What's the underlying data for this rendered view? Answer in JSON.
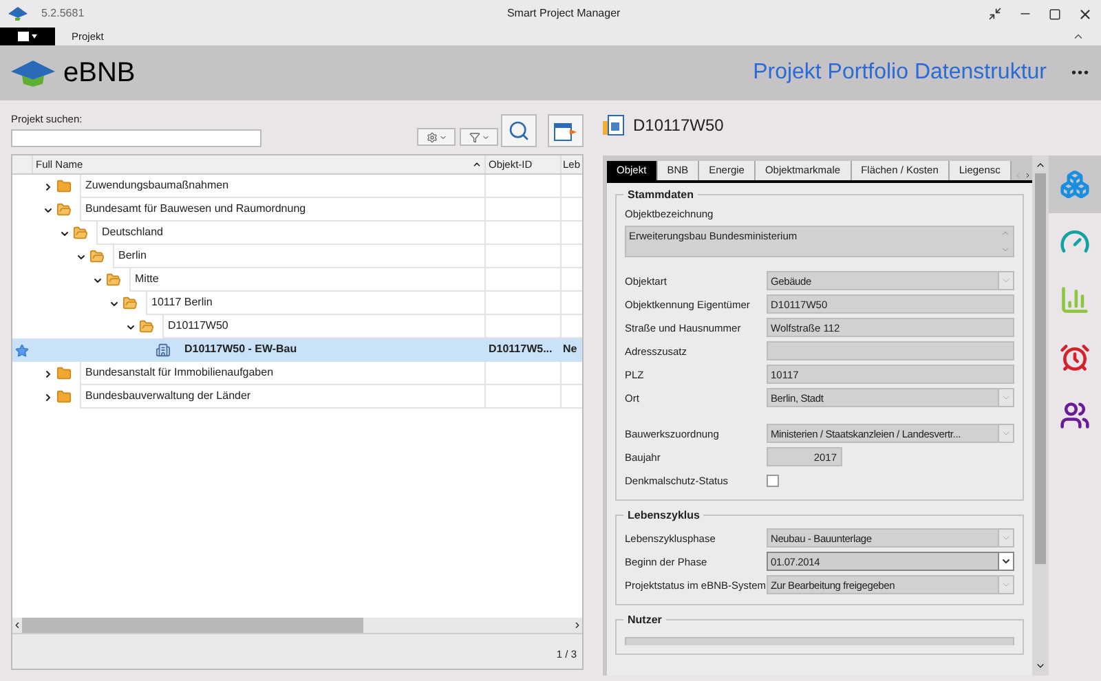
{
  "titlebar": {
    "version": "5.2.5681",
    "title": "Smart Project Manager"
  },
  "ribbon": {
    "tabs": [
      {
        "label": "Projekt",
        "selected": false
      }
    ]
  },
  "header": {
    "logo_text": "eBNB",
    "title": "Projekt Portfolio Datenstruktur",
    "more": "•••"
  },
  "search": {
    "label": "Projekt suchen:"
  },
  "tree": {
    "columns": [
      "Full Name",
      "Objekt-ID",
      "Leb"
    ],
    "rows": [
      {
        "name": "Zuwendungsbaumaßnahmen",
        "kind": "folder",
        "expanded": false,
        "selected": false,
        "favorite": false
      },
      {
        "name": "Bundesamt für Bauwesen und Raumordnung",
        "kind": "folder",
        "expanded": true,
        "selected": false,
        "favorite": false,
        "children": [
          {
            "name": "Deutschland",
            "kind": "folder",
            "expanded": true,
            "selected": false,
            "favorite": false,
            "children": [
              {
                "name": "Berlin",
                "kind": "folder",
                "expanded": true,
                "selected": false,
                "favorite": false,
                "children": [
                  {
                    "name": "Mitte",
                    "kind": "folder",
                    "expanded": true,
                    "selected": false,
                    "favorite": false,
                    "children": [
                      {
                        "name": "10117 Berlin",
                        "kind": "folder",
                        "expanded": true,
                        "selected": false,
                        "favorite": false,
                        "children": [
                          {
                            "name": "D10117W50",
                            "kind": "folder",
                            "expanded": true,
                            "selected": false,
                            "favorite": false,
                            "children": [
                              {
                                "name": "D10117W50 - EW-Bau",
                                "kind": "building",
                                "selected": true,
                                "favorite": true,
                                "id": "D10117W5...",
                                "column_3": "Ne"
                              }
                            ]
                          }
                        ]
                      }
                    ]
                  }
                ]
              }
            ]
          }
        ]
      },
      {
        "name": "Bundesanstalt für Immobilienaufgaben",
        "kind": "folder",
        "expanded": false,
        "selected": false,
        "favorite": false
      },
      {
        "name": "Bundesbauverwaltung der Länder",
        "kind": "folder",
        "expanded": false,
        "selected": false,
        "favorite": false
      }
    ],
    "pager": "1 / 3"
  },
  "detail": {
    "title": "D10117W50",
    "tabs": [
      {
        "label": "Objekt",
        "selected": true
      },
      {
        "label": "BNB",
        "selected": false
      },
      {
        "label": "Energie",
        "selected": false
      },
      {
        "label": "Objektmarkmale",
        "selected": false
      },
      {
        "label": "Flächen / Kosten",
        "selected": false
      },
      {
        "label": "Liegensc",
        "selected": false
      }
    ],
    "sections": [
      {
        "title": "Stammdaten",
        "fields": [
          {
            "kind": "textarea",
            "label": "Objektbezeichnung",
            "value": "Erweiterungsbau Bundesministerium"
          },
          {
            "kind": "dropdown",
            "label": "Objektart",
            "value": "Gebäude",
            "disabled": true
          },
          {
            "kind": "text",
            "label": "Objektkennung Eigentümer",
            "value": "D10117W50"
          },
          {
            "kind": "text",
            "label": "Straße und Hausnummer",
            "value": "Wolfstraße 112"
          },
          {
            "kind": "text",
            "label": "Adresszusatz"
          },
          {
            "kind": "text",
            "label": "PLZ",
            "value": "10117"
          },
          {
            "kind": "dropdown",
            "label": "Ort",
            "value": "Berlin, Stadt",
            "disabled": true
          },
          {
            "kind": "gap"
          },
          {
            "kind": "dropdown",
            "label": "Bauwerkszuordnung",
            "value": "Ministerien / Staatskanzleien / Landesvertr...",
            "disabled": true
          },
          {
            "kind": "number",
            "label": "Baujahr",
            "value": "2017"
          },
          {
            "kind": "checkbox",
            "label": "Denkmalschutz-Status",
            "checked": false
          }
        ]
      },
      {
        "title": "Lebenszyklus",
        "fields": [
          {
            "kind": "dropdown",
            "label": "Lebenszyklusphase",
            "value": "Neubau - Bauunterlage",
            "disabled": true
          },
          {
            "kind": "dropdown",
            "label": "Beginn der Phase",
            "value": "01.07.2014",
            "disabled": false
          },
          {
            "kind": "dropdown",
            "label": "Projektstatus im eBNB-System",
            "value": "Zur Bearbeitung freigegeben",
            "disabled": true
          }
        ]
      },
      {
        "title": "Nutzer",
        "fields": [
          {
            "kind": "cut"
          }
        ]
      }
    ]
  },
  "side_items": [
    {
      "kind": "cubes",
      "selected": true
    },
    {
      "kind": "gauge",
      "selected": false
    },
    {
      "kind": "chart",
      "selected": false
    },
    {
      "kind": "alarm",
      "selected": false
    },
    {
      "kind": "users",
      "selected": false
    }
  ]
}
